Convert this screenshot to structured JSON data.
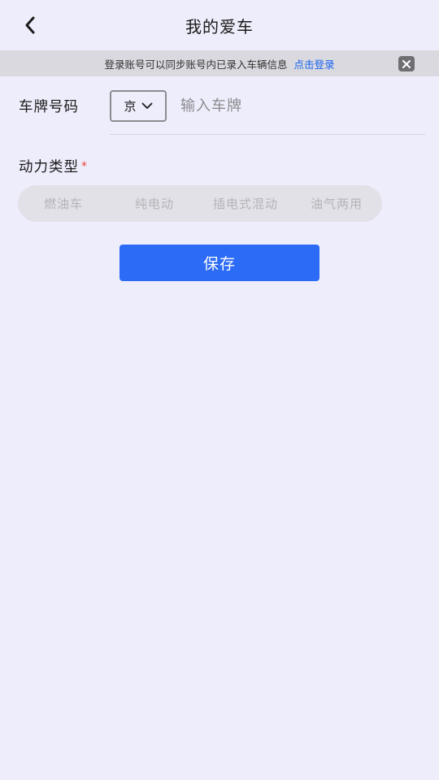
{
  "header": {
    "title": "我的爱车",
    "back_icon": "chevron-left-icon"
  },
  "notice": {
    "text": "登录账号可以同步账号内已录入车辆信息",
    "link": "点击登录",
    "close_icon": "close-icon"
  },
  "plate": {
    "label": "车牌号码",
    "province": "京",
    "placeholder": "输入车牌",
    "value": ""
  },
  "power": {
    "label": "动力类型",
    "required_mark": "*",
    "options": [
      {
        "label": "燃油车"
      },
      {
        "label": "纯电动"
      },
      {
        "label": "插电式混动"
      },
      {
        "label": "油气两用"
      }
    ]
  },
  "save": {
    "label": "保存"
  },
  "colors": {
    "background": "#eeedfb",
    "accent": "#2b6bf6",
    "link": "#1a64f0",
    "required": "#e8413a"
  }
}
